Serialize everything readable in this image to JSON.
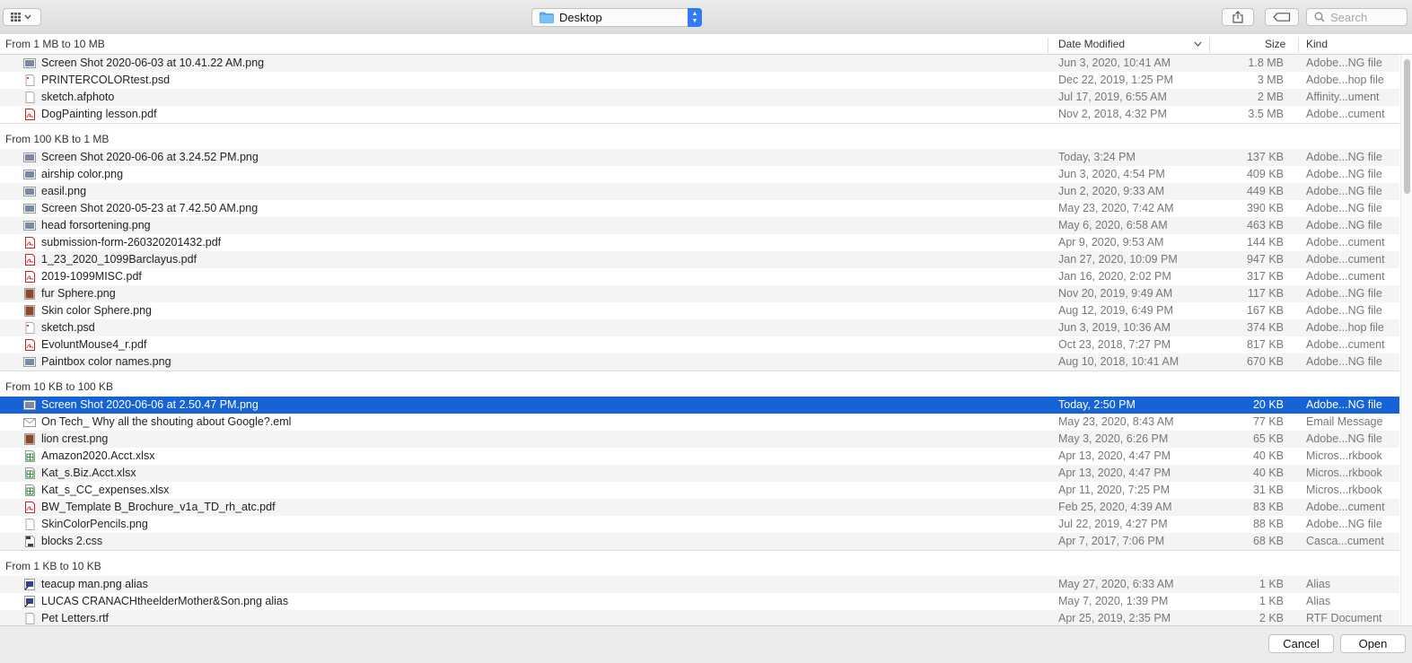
{
  "toolbar": {
    "view_icon": "icon-view-grid",
    "location": "Desktop",
    "search_placeholder": "Search"
  },
  "columns": {
    "group_label": "From 1 MB to 10 MB",
    "date": "Date Modified",
    "size": "Size",
    "kind": "Kind"
  },
  "groups": [
    {
      "label": "From 1 MB to 10 MB",
      "rows": [
        {
          "icon": "png",
          "name": "Screen Shot 2020-06-03 at 10.41.22 AM.png",
          "date": "Jun 3, 2020, 10:41 AM",
          "size": "1.8 MB",
          "kind": "Adobe...NG file"
        },
        {
          "icon": "psd",
          "name": "PRINTERCOLORtest.psd",
          "date": "Dec 22, 2019, 1:25 PM",
          "size": "3 MB",
          "kind": "Adobe...hop file"
        },
        {
          "icon": "doc",
          "name": "sketch.afphoto",
          "date": "Jul 17, 2019, 6:55 AM",
          "size": "2 MB",
          "kind": "Affinity...ument"
        },
        {
          "icon": "pdf",
          "name": "DogPainting lesson.pdf",
          "date": "Nov 2, 2018, 4:32 PM",
          "size": "3.5 MB",
          "kind": "Adobe...cument"
        }
      ]
    },
    {
      "label": "From 100 KB to 1 MB",
      "rows": [
        {
          "icon": "png",
          "name": "Screen Shot 2020-06-06 at 3.24.52 PM.png",
          "date": "Today, 3:24 PM",
          "size": "137 KB",
          "kind": "Adobe...NG file"
        },
        {
          "icon": "png",
          "name": "airship color.png",
          "date": "Jun 3, 2020, 4:54 PM",
          "size": "409 KB",
          "kind": "Adobe...NG file"
        },
        {
          "icon": "png",
          "name": "easil.png",
          "date": "Jun 2, 2020, 9:33 AM",
          "size": "449 KB",
          "kind": "Adobe...NG file"
        },
        {
          "icon": "png",
          "name": "Screen Shot 2020-05-23 at 7.42.50 AM.png",
          "date": "May 23, 2020, 7:42 AM",
          "size": "390 KB",
          "kind": "Adobe...NG file"
        },
        {
          "icon": "png",
          "name": "head forsortening.png",
          "date": "May 6, 2020, 6:58 AM",
          "size": "463 KB",
          "kind": "Adobe...NG file"
        },
        {
          "icon": "pdf",
          "name": "submission-form-260320201432.pdf",
          "date": "Apr 9, 2020, 9:53 AM",
          "size": "144 KB",
          "kind": "Adobe...cument"
        },
        {
          "icon": "pdf",
          "name": "1_23_2020_1099Barclayus.pdf",
          "date": "Jan 27, 2020, 10:09 PM",
          "size": "947 KB",
          "kind": "Adobe...cument"
        },
        {
          "icon": "pdf",
          "name": "2019-1099MISC.pdf",
          "date": "Jan 16, 2020, 2:02 PM",
          "size": "317 KB",
          "kind": "Adobe...cument"
        },
        {
          "icon": "img",
          "name": "fur Sphere.png",
          "date": "Nov 20, 2019, 9:49 AM",
          "size": "117 KB",
          "kind": "Adobe...NG file"
        },
        {
          "icon": "img",
          "name": "Skin color Sphere.png",
          "date": "Aug 12, 2019, 6:49 PM",
          "size": "167 KB",
          "kind": "Adobe...NG file"
        },
        {
          "icon": "psd",
          "name": "sketch.psd",
          "date": "Jun 3, 2019, 10:36 AM",
          "size": "374 KB",
          "kind": "Adobe...hop file"
        },
        {
          "icon": "pdf",
          "name": "EvoluntMouse4_r.pdf",
          "date": "Oct 23, 2018, 7:27 PM",
          "size": "817 KB",
          "kind": "Adobe...cument"
        },
        {
          "icon": "png",
          "name": "Paintbox color names.png",
          "date": "Aug 10, 2018, 10:41 AM",
          "size": "670 KB",
          "kind": "Adobe...NG file"
        }
      ]
    },
    {
      "label": "From 10 KB to 100 KB",
      "rows": [
        {
          "icon": "png",
          "name": "Screen Shot 2020-06-06 at 2.50.47 PM.png",
          "date": "Today, 2:50 PM",
          "size": "20 KB",
          "kind": "Adobe...NG file",
          "selected": true
        },
        {
          "icon": "eml",
          "name": "On Tech_ Why all the shouting about Google?.eml",
          "date": "May 23, 2020, 8:43 AM",
          "size": "77 KB",
          "kind": "Email Message"
        },
        {
          "icon": "img",
          "name": "lion crest.png",
          "date": "May 3, 2020, 6:26 PM",
          "size": "65 KB",
          "kind": "Adobe...NG file"
        },
        {
          "icon": "xls",
          "name": "Amazon2020.Acct.xlsx",
          "date": "Apr 13, 2020, 4:47 PM",
          "size": "40 KB",
          "kind": "Micros...rkbook"
        },
        {
          "icon": "xls",
          "name": "Kat_s.Biz.Acct.xlsx",
          "date": "Apr 13, 2020, 4:47 PM",
          "size": "40 KB",
          "kind": "Micros...rkbook"
        },
        {
          "icon": "xls",
          "name": "Kat_s_CC_expenses.xlsx",
          "date": "Apr 11, 2020, 7:25 PM",
          "size": "31 KB",
          "kind": "Micros...rkbook"
        },
        {
          "icon": "pdf",
          "name": "BW_Template B_Brochure_v1a_TD_rh_atc.pdf",
          "date": "Feb 25, 2020, 4:39 AM",
          "size": "83 KB",
          "kind": "Adobe...cument"
        },
        {
          "icon": "doc",
          "name": "SkinColorPencils.png",
          "date": "Jul 22, 2019, 4:27 PM",
          "size": "88 KB",
          "kind": "Adobe...NG file"
        },
        {
          "icon": "css",
          "name": "blocks 2.css",
          "date": "Apr 7, 2017, 7:06 PM",
          "size": "68 KB",
          "kind": "Casca...cument"
        }
      ]
    },
    {
      "label": "From 1 KB to 10 KB",
      "rows": [
        {
          "icon": "alias",
          "name": "teacup man.png alias",
          "date": "May 27, 2020, 6:33 AM",
          "size": "1 KB",
          "kind": "Alias"
        },
        {
          "icon": "alias",
          "name": "LUCAS CRANACHtheelderMother&Son.png alias",
          "date": "May 7, 2020, 1:39 PM",
          "size": "1 KB",
          "kind": "Alias"
        },
        {
          "icon": "doc",
          "name": "Pet Letters.rtf",
          "date": "Apr 25, 2019, 2:35 PM",
          "size": "2 KB",
          "kind": "RTF Document"
        }
      ]
    }
  ],
  "footer": {
    "cancel": "Cancel",
    "open": "Open"
  },
  "colors": {
    "selection": "#1663d6",
    "accent": "#2f7cf6"
  }
}
